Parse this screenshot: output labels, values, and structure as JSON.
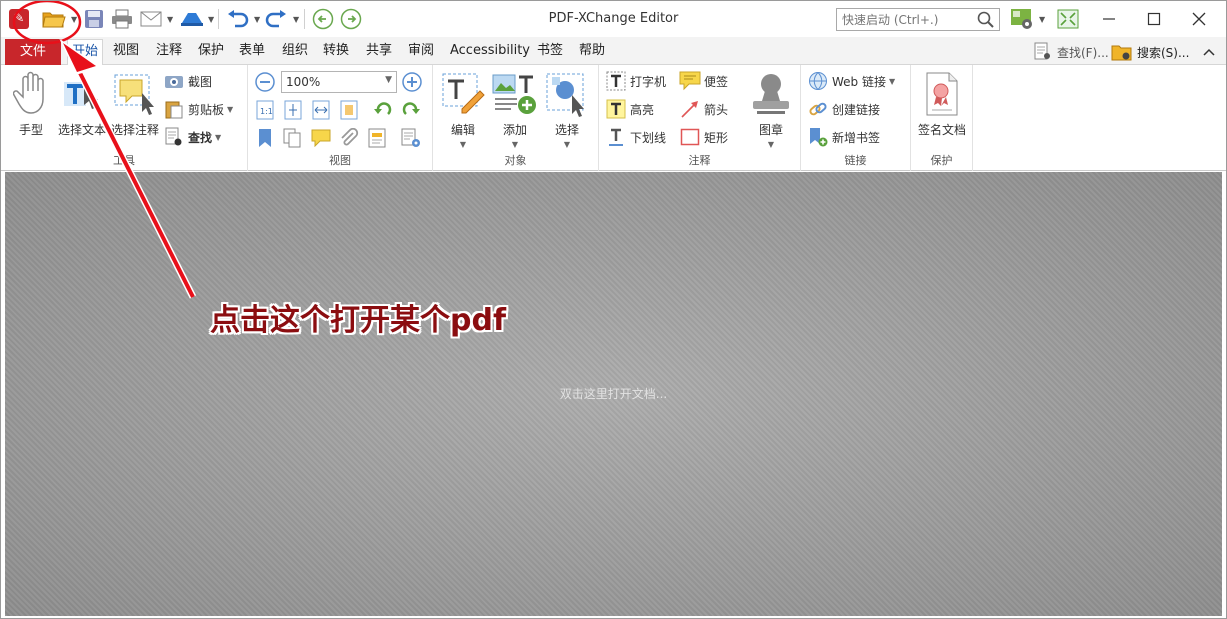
{
  "window": {
    "title": "PDF-XChange Editor",
    "quick_search_placeholder": "快速启动 (Ctrl+.)"
  },
  "tabs": {
    "file": "文件",
    "items": [
      "开始",
      "视图",
      "注释",
      "保护",
      "表单",
      "组织",
      "转换",
      "共享",
      "审阅",
      "Accessibility",
      "书签",
      "帮助"
    ],
    "active": "开始",
    "find": "查找(F)...",
    "search": "搜索(S)..."
  },
  "ribbon": {
    "tools": {
      "hand": "手型",
      "select_text": "选择文本",
      "select_comment": "选择注释",
      "snapshot": "截图",
      "clipboard": "剪贴板",
      "find": "查找",
      "label": "工具"
    },
    "view": {
      "zoom_value": "100%",
      "label": "视图"
    },
    "objects": {
      "edit": "编辑",
      "add": "添加",
      "select": "选择",
      "label": "对象"
    },
    "comments": {
      "typewriter": "打字机",
      "note": "便签",
      "highlight": "高亮",
      "arrow": "箭头",
      "underline": "下划线",
      "rectangle": "矩形",
      "stamp": "图章",
      "label": "注释"
    },
    "links": {
      "web_links": "Web 链接",
      "create_link": "创建链接",
      "add_bookmark": "新增书签",
      "label": "链接"
    },
    "protect": {
      "sign_document": "签名文档",
      "label": "保护"
    }
  },
  "document": {
    "hint": "双击这里打开文档..."
  },
  "annotation": {
    "text": "点击这个打开某个pdf",
    "color": "#e8101a"
  },
  "colors": {
    "brand": "#c8262b",
    "active_tab_text": "#1a55a8",
    "folder": "#f0b429"
  }
}
